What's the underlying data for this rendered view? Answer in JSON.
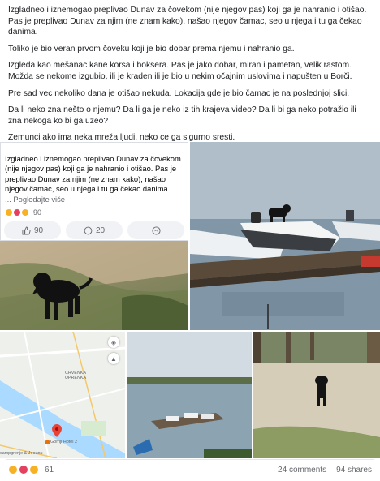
{
  "post": {
    "paragraphs": [
      "Izgladneo i iznemogao preplivao Dunav za čovekom (nije njegov pas) koji ga je nahranio i otišao. Pas je preplivao Dunav za njim (ne znam kako), našao njegov čamac, seo u njega i tu ga čekao danima.",
      "Toliko je bio veran prvom čoveku koji je bio dobar prema njemu i nahranio ga.",
      "Izgleda kao mešanac kane korsa i boksera. Pas je jako dobar, miran i pametan, velik rastom. Možda se nekome izgubio, ili je kraden ili je bio u nekim očajnim uslovima i napušten u Borči.",
      "Pre sad vec nekoliko dana je otišao nekuda. Lokacija gde je bio čamac je na poslednjoj slici.",
      "Da li neko zna nešto o njemu? Da li ga je neko iz tih krajeva video? Da li bi ga neko potražio ili zna nekoga ko bi ga uzeo?",
      "Zemunci ako ima neka mreža ljudi, neko ce ga sigurno sresti."
    ]
  },
  "shared_post": {
    "text": "Izgladneo i iznemogao preplivao Dunav za čovekom (nije njegov pas) koji ga je nahranio i otišao. Pas je preplivao Dunav za njim (ne znam kako), našao njegov čamac, seo u njega i tu ga čekao danima.",
    "see_more": "... Pogledajte više",
    "reaction_count": "90",
    "like_count": "90",
    "comment_count": "20",
    "reaction_colors": [
      "#f7b125",
      "#e4405f",
      "#f7b125"
    ]
  },
  "map": {
    "labels": {
      "upper": "CRVENKA\nUPRENKA",
      "place": "Gornji Hotel 2",
      "edge": "campgrenje & Jeounu"
    },
    "pin_color": "#ea4335",
    "river_color": "#aadaff"
  },
  "footer": {
    "reaction_count": "61",
    "comments": "24 comments",
    "shares": "94 shares",
    "reaction_colors": [
      "#f7b125",
      "#e4405f",
      "#f7b125"
    ]
  }
}
